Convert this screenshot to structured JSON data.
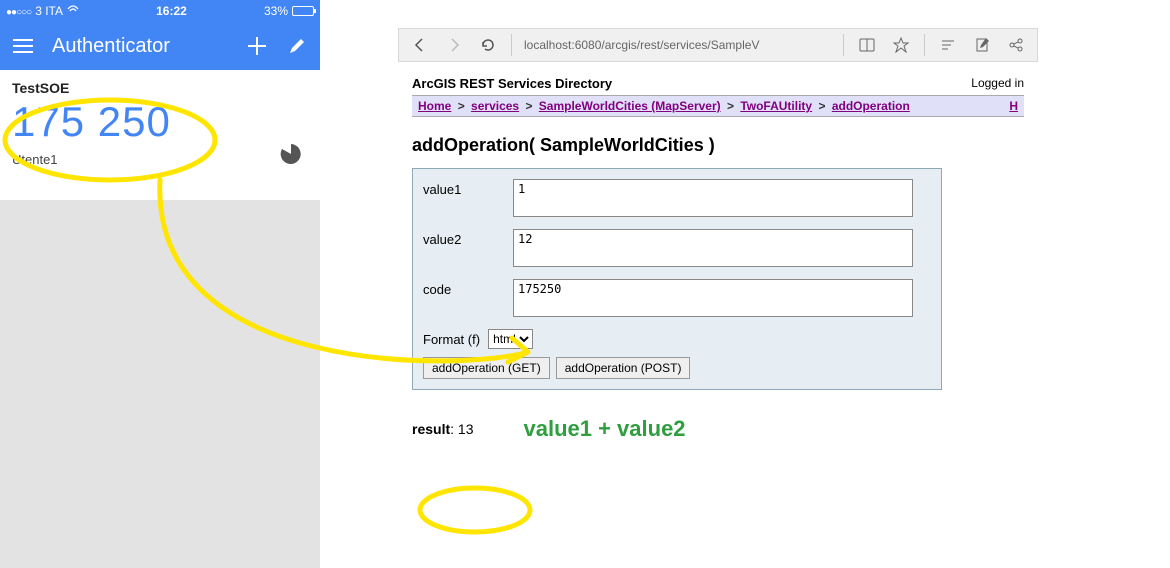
{
  "phone": {
    "status": {
      "carrier": "3 ITA",
      "time": "16:22",
      "battery_pct": "33%"
    },
    "app_title": "Authenticator",
    "entry": {
      "name": "TestSOE",
      "code": "175 250",
      "user": "Utente1"
    }
  },
  "browser": {
    "url": "localhost:6080/arcgis/rest/services/SampleV",
    "dir_title": "ArcGIS REST Services Directory",
    "logged_in": "Logged in",
    "breadcrumb": {
      "home": "Home",
      "services": "services",
      "layer": "SampleWorldCities (MapServer)",
      "util": "TwoFAUtility",
      "op": "addOperation",
      "tail": "H"
    },
    "op_title": "addOperation( SampleWorldCities )",
    "form": {
      "labels": {
        "value1": "value1",
        "value2": "value2",
        "code": "code",
        "format": "Format (f)"
      },
      "values": {
        "value1": "1",
        "value2": "12",
        "code": "175250"
      },
      "format_selected": "html",
      "btn_get": "addOperation (GET)",
      "btn_post": "addOperation (POST)"
    },
    "result": {
      "key": "result",
      "value": "13"
    },
    "annotation": "value1 + value2"
  }
}
